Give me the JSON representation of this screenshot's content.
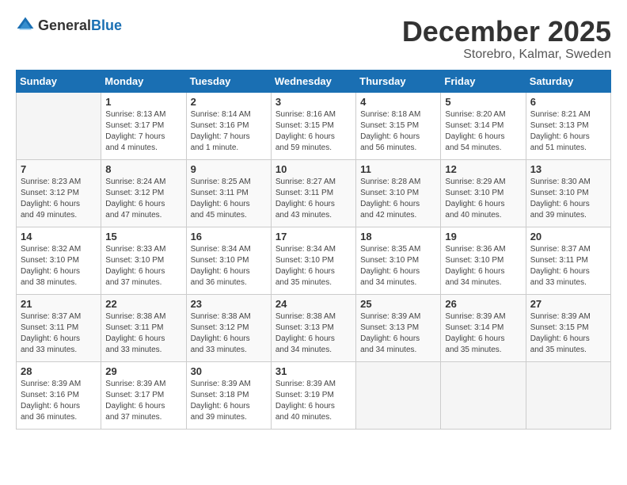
{
  "logo": {
    "general": "General",
    "blue": "Blue"
  },
  "title": "December 2025",
  "subtitle": "Storebro, Kalmar, Sweden",
  "weekdays": [
    "Sunday",
    "Monday",
    "Tuesday",
    "Wednesday",
    "Thursday",
    "Friday",
    "Saturday"
  ],
  "weeks": [
    [
      {
        "day": "",
        "info": ""
      },
      {
        "day": "1",
        "info": "Sunrise: 8:13 AM\nSunset: 3:17 PM\nDaylight: 7 hours\nand 4 minutes."
      },
      {
        "day": "2",
        "info": "Sunrise: 8:14 AM\nSunset: 3:16 PM\nDaylight: 7 hours\nand 1 minute."
      },
      {
        "day": "3",
        "info": "Sunrise: 8:16 AM\nSunset: 3:15 PM\nDaylight: 6 hours\nand 59 minutes."
      },
      {
        "day": "4",
        "info": "Sunrise: 8:18 AM\nSunset: 3:15 PM\nDaylight: 6 hours\nand 56 minutes."
      },
      {
        "day": "5",
        "info": "Sunrise: 8:20 AM\nSunset: 3:14 PM\nDaylight: 6 hours\nand 54 minutes."
      },
      {
        "day": "6",
        "info": "Sunrise: 8:21 AM\nSunset: 3:13 PM\nDaylight: 6 hours\nand 51 minutes."
      }
    ],
    [
      {
        "day": "7",
        "info": "Sunrise: 8:23 AM\nSunset: 3:12 PM\nDaylight: 6 hours\nand 49 minutes."
      },
      {
        "day": "8",
        "info": "Sunrise: 8:24 AM\nSunset: 3:12 PM\nDaylight: 6 hours\nand 47 minutes."
      },
      {
        "day": "9",
        "info": "Sunrise: 8:25 AM\nSunset: 3:11 PM\nDaylight: 6 hours\nand 45 minutes."
      },
      {
        "day": "10",
        "info": "Sunrise: 8:27 AM\nSunset: 3:11 PM\nDaylight: 6 hours\nand 43 minutes."
      },
      {
        "day": "11",
        "info": "Sunrise: 8:28 AM\nSunset: 3:10 PM\nDaylight: 6 hours\nand 42 minutes."
      },
      {
        "day": "12",
        "info": "Sunrise: 8:29 AM\nSunset: 3:10 PM\nDaylight: 6 hours\nand 40 minutes."
      },
      {
        "day": "13",
        "info": "Sunrise: 8:30 AM\nSunset: 3:10 PM\nDaylight: 6 hours\nand 39 minutes."
      }
    ],
    [
      {
        "day": "14",
        "info": "Sunrise: 8:32 AM\nSunset: 3:10 PM\nDaylight: 6 hours\nand 38 minutes."
      },
      {
        "day": "15",
        "info": "Sunrise: 8:33 AM\nSunset: 3:10 PM\nDaylight: 6 hours\nand 37 minutes."
      },
      {
        "day": "16",
        "info": "Sunrise: 8:34 AM\nSunset: 3:10 PM\nDaylight: 6 hours\nand 36 minutes."
      },
      {
        "day": "17",
        "info": "Sunrise: 8:34 AM\nSunset: 3:10 PM\nDaylight: 6 hours\nand 35 minutes."
      },
      {
        "day": "18",
        "info": "Sunrise: 8:35 AM\nSunset: 3:10 PM\nDaylight: 6 hours\nand 34 minutes."
      },
      {
        "day": "19",
        "info": "Sunrise: 8:36 AM\nSunset: 3:10 PM\nDaylight: 6 hours\nand 34 minutes."
      },
      {
        "day": "20",
        "info": "Sunrise: 8:37 AM\nSunset: 3:11 PM\nDaylight: 6 hours\nand 33 minutes."
      }
    ],
    [
      {
        "day": "21",
        "info": "Sunrise: 8:37 AM\nSunset: 3:11 PM\nDaylight: 6 hours\nand 33 minutes."
      },
      {
        "day": "22",
        "info": "Sunrise: 8:38 AM\nSunset: 3:11 PM\nDaylight: 6 hours\nand 33 minutes."
      },
      {
        "day": "23",
        "info": "Sunrise: 8:38 AM\nSunset: 3:12 PM\nDaylight: 6 hours\nand 33 minutes."
      },
      {
        "day": "24",
        "info": "Sunrise: 8:38 AM\nSunset: 3:13 PM\nDaylight: 6 hours\nand 34 minutes."
      },
      {
        "day": "25",
        "info": "Sunrise: 8:39 AM\nSunset: 3:13 PM\nDaylight: 6 hours\nand 34 minutes."
      },
      {
        "day": "26",
        "info": "Sunrise: 8:39 AM\nSunset: 3:14 PM\nDaylight: 6 hours\nand 35 minutes."
      },
      {
        "day": "27",
        "info": "Sunrise: 8:39 AM\nSunset: 3:15 PM\nDaylight: 6 hours\nand 35 minutes."
      }
    ],
    [
      {
        "day": "28",
        "info": "Sunrise: 8:39 AM\nSunset: 3:16 PM\nDaylight: 6 hours\nand 36 minutes."
      },
      {
        "day": "29",
        "info": "Sunrise: 8:39 AM\nSunset: 3:17 PM\nDaylight: 6 hours\nand 37 minutes."
      },
      {
        "day": "30",
        "info": "Sunrise: 8:39 AM\nSunset: 3:18 PM\nDaylight: 6 hours\nand 39 minutes."
      },
      {
        "day": "31",
        "info": "Sunrise: 8:39 AM\nSunset: 3:19 PM\nDaylight: 6 hours\nand 40 minutes."
      },
      {
        "day": "",
        "info": ""
      },
      {
        "day": "",
        "info": ""
      },
      {
        "day": "",
        "info": ""
      }
    ]
  ]
}
